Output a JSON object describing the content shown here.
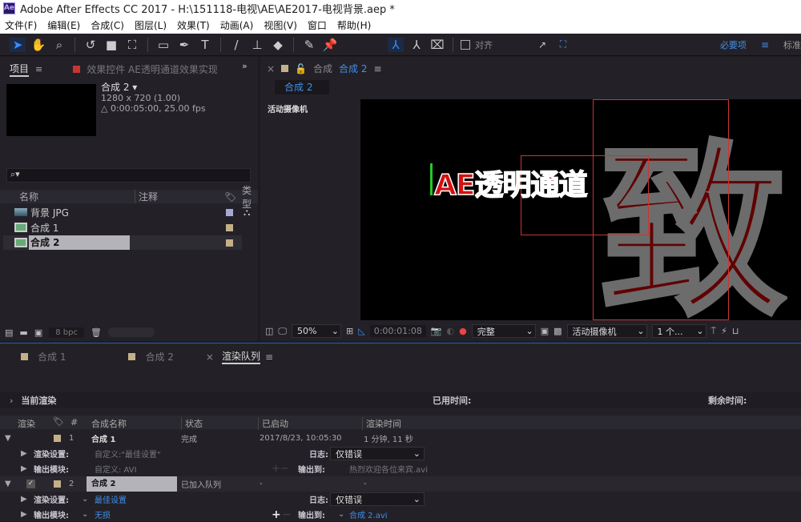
{
  "window": {
    "logo": "Ae",
    "title": "Adobe After Effects CC 2017 - H:\\151118-电视\\AE\\AE2017-电视背景.aep *"
  },
  "menu": [
    "文件(F)",
    "编辑(E)",
    "合成(C)",
    "图层(L)",
    "效果(T)",
    "动画(A)",
    "视图(V)",
    "窗口",
    "帮助(H)"
  ],
  "toolbar": {
    "tools": [
      "selection-tool",
      "hand-tool",
      "zoom-tool",
      "rotate-tool",
      "camera-tool",
      "pan-behind-tool",
      "rectangle-tool",
      "pen-tool",
      "type-tool",
      "brush-tool",
      "clone-stamp-tool",
      "eraser-tool",
      "roto-brush-tool",
      "puppet-pin-tool"
    ],
    "align_label": "对齐",
    "workspace_active": "必要项",
    "workspace_next": "标准"
  },
  "project": {
    "tab": "项目",
    "effects_tab": "效果控件 AE透明通道效果实现",
    "comp_name": "合成 2 ▾",
    "resolution": "1280 x 720 (1.00)",
    "duration": "△ 0:00:05:00, 25.00 fps",
    "search_placeholder": "",
    "columns": {
      "name": "名称",
      "comment": "注释",
      "type": "类型"
    },
    "items": [
      {
        "name": "背景 JPG",
        "label_color": "#a8a8d8"
      },
      {
        "name": "合成 1",
        "label_color": "#c4b088"
      },
      {
        "name": "合成 2",
        "label_color": "#c4b088"
      }
    ],
    "bpc": "8 bpc"
  },
  "viewer": {
    "tab_prefix": "合成",
    "tab_name": "合成 2",
    "sub_tab": "合成 2",
    "camera_label": "活动摄像机",
    "overlay_text": "AE透明通道",
    "bg_text": "致",
    "zoom": "50%",
    "timecode": "0:00:01:08",
    "resolution": "完整",
    "view": "活动摄像机",
    "views_count": "1 个..."
  },
  "bottom_tabs": [
    {
      "label": "合成 1"
    },
    {
      "label": "合成 2"
    },
    {
      "label": "渲染队列",
      "active": true
    }
  ],
  "render_queue": {
    "current_render": "当前渲染",
    "elapsed_label": "已用时间:",
    "remaining_label": "剩余时间:",
    "columns": [
      "渲染",
      "#",
      "合成名称",
      "状态",
      "已启动",
      "渲染时间"
    ],
    "items": [
      {
        "num": "1",
        "name": "合成 1",
        "status": "完成",
        "started": "2017/8/23, 10:05:30",
        "render_time": "1 分钟, 11 秒",
        "render_settings_label": "渲染设置:",
        "render_settings": "自定义:\"最佳设置\"",
        "log_label": "日志:",
        "log": "仅错误",
        "output_module_label": "输出模块:",
        "output_module": "自定义: AVI",
        "output_to_label": "输出到:",
        "output_to": "热烈欢迎各位来宾.avi"
      },
      {
        "num": "2",
        "name": "合成 2",
        "status": "已加入队列",
        "started": "-",
        "render_time": "-",
        "render_settings_label": "渲染设置:",
        "render_settings": "最佳设置",
        "log_label": "日志:",
        "log": "仅错误",
        "output_module_label": "输出模块:",
        "output_module": "无损",
        "output_to_label": "输出到:",
        "output_to": "合成 2.avi"
      }
    ]
  }
}
